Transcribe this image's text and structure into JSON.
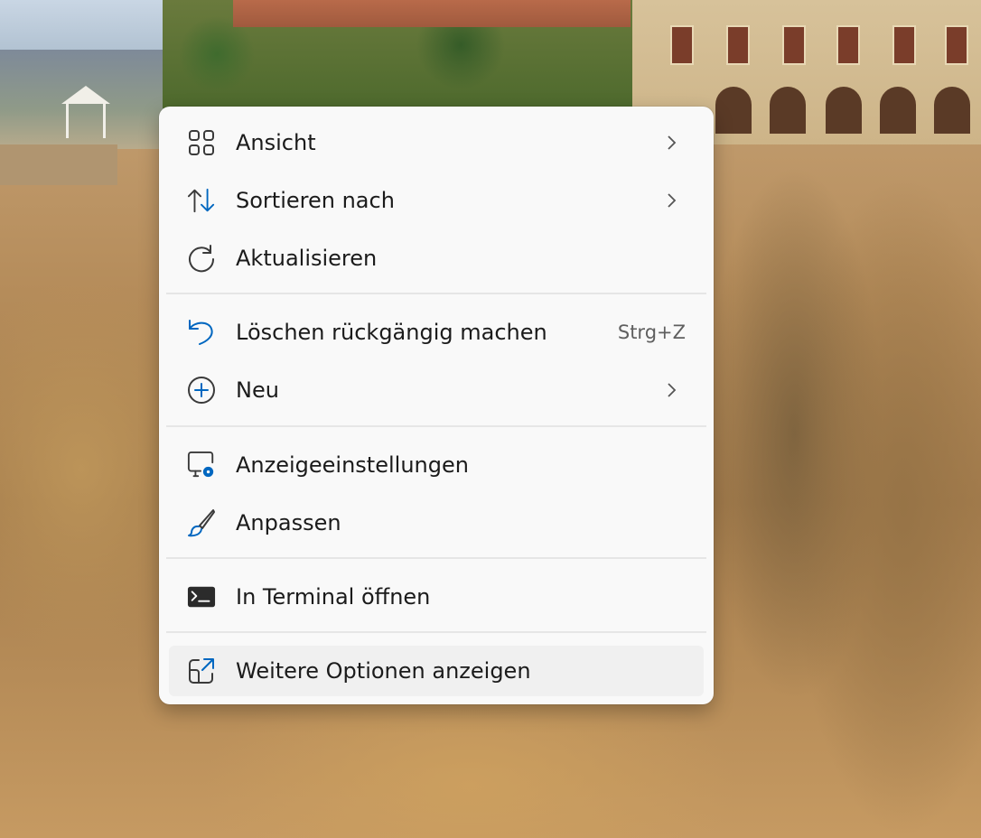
{
  "context_menu": {
    "items": [
      {
        "label": "Ansicht",
        "icon": "grid-view-icon",
        "submenu": true
      },
      {
        "label": "Sortieren nach",
        "icon": "sort-arrows-icon",
        "submenu": true
      },
      {
        "label": "Aktualisieren",
        "icon": "refresh-icon",
        "submenu": false
      },
      {
        "label": "Löschen rückgängig machen",
        "icon": "undo-icon",
        "shortcut": "Strg+Z"
      },
      {
        "label": "Neu",
        "icon": "new-plus-icon",
        "submenu": true
      },
      {
        "label": "Anzeigeeinstellungen",
        "icon": "display-settings-icon"
      },
      {
        "label": "Anpassen",
        "icon": "brush-icon"
      },
      {
        "label": "In Terminal öffnen",
        "icon": "terminal-icon"
      },
      {
        "label": "Weitere Optionen anzeigen",
        "icon": "open-external-icon",
        "highlighted": true
      }
    ]
  },
  "colors": {
    "accent": "#0067c0",
    "menu_bg": "#f9f9f9",
    "text": "#1b1b1b",
    "hover": "#f0f0f0"
  }
}
